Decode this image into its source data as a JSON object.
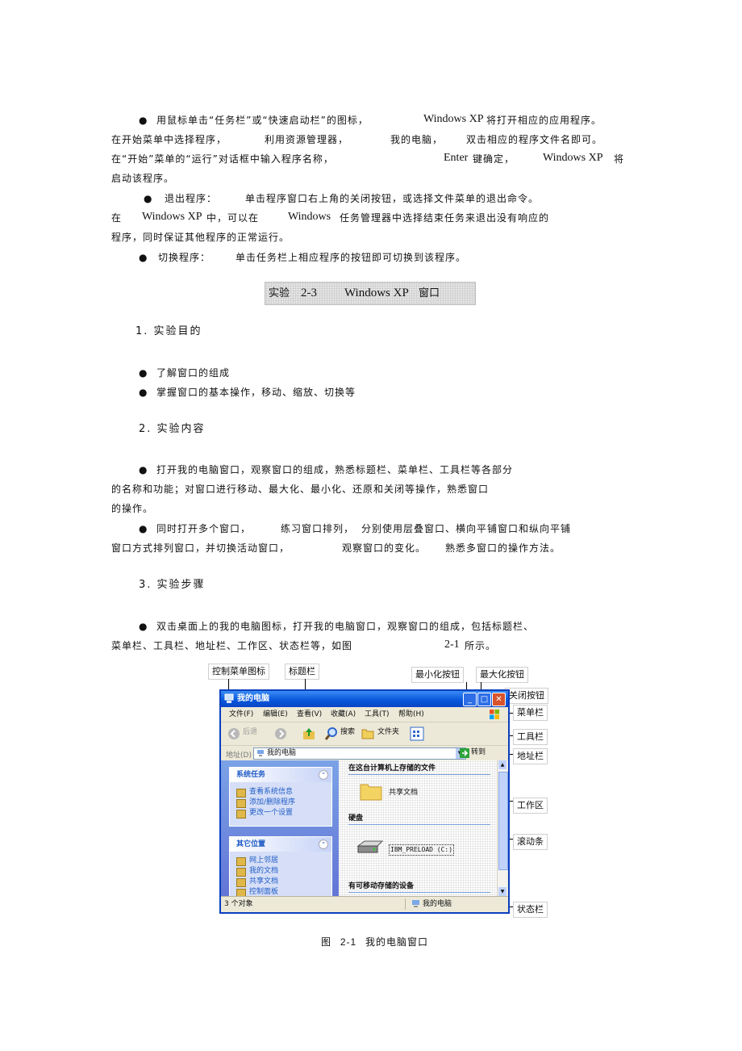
{
  "body": {
    "p1_l1_a": "用鼠标单击“任务栏”或“快速启动栏”的图标，",
    "p1_l1_b": "Windows  XP",
    "p1_l1_c": "将打开相应的应用程序。",
    "p1_l2_a": "在开始菜单中选择程序，",
    "p1_l2_b": "利用资源管理器，",
    "p1_l2_c": "我的电脑，",
    "p1_l2_d": "双击相应的程序文件名即可。",
    "p1_l3_a": "在“开始”菜单的“运行”对话框中输入程序名称，",
    "p1_l3_b": "Enter",
    "p1_l3_c": "键确定，",
    "p1_l3_d": "Windows XP",
    "p1_l3_e": "将",
    "p1_l4": "启动该程序。",
    "p2_l1_a": "退出程序：",
    "p2_l1_b": "单击程序窗口右上角的关闭按钮，或选择文件菜单的退出命令。",
    "p2_l2_a": "在",
    "p2_l2_b": "Windows  XP",
    "p2_l2_c": "中，可以在",
    "p2_l2_d": "Windows",
    "p2_l2_e": "任务管理器中选择结束任务来退出没有响应的",
    "p2_l3": "程序，同时保证其他程序的正常运行。",
    "p3_l1_a": "切换程序：",
    "p3_l1_b": "单击任务栏上相应程序的按钮即可切换到该程序。"
  },
  "heading": {
    "part1": "实验",
    "part2": "2-3",
    "part3": "Windows XP",
    "part4": "窗口"
  },
  "sections": {
    "s1": "1. 实验目的",
    "s1_item1": "了解窗口的组成",
    "s1_item2": "掌握窗口的基本操作，移动、缩放、切换等",
    "s2": "2. 实验内容",
    "s2_p1_l1": "打开我的电脑窗口，观察窗口的组成，熟悉标题栏、菜单栏、工具栏等各部分",
    "s2_p1_l2": "的名称和功能；对窗口进行移动、最大化、最小化、还原和关闭等操作，熟悉窗口",
    "s2_p1_l3": "的操作。",
    "s2_p2_l1_a": "同时打开多个窗口，",
    "s2_p2_l1_b": "练习窗口排列，",
    "s2_p2_l1_c": "分别使用层叠窗口、横向平铺窗口和纵向平铺",
    "s2_p2_l2_a": "窗口方式排列窗口，并切换活动窗口，",
    "s2_p2_l2_b": "观察窗口的变化。",
    "s2_p2_l2_c": "熟悉多窗口的操作方法。",
    "s3": "3. 实验步骤",
    "s3_p1_l1": "双击桌面上的我的电脑图标，打开我的电脑窗口，观察窗口的组成，包括标题栏、",
    "s3_p1_l2": "菜单栏、工具栏、地址栏、工作区、状态栏等，如图",
    "s3_p1_l2_b": "2-1",
    "s3_p1_l2_c": "所示。"
  },
  "figure": {
    "callouts": {
      "control_menu_icon": "控制菜单图标",
      "title_bar": "标题栏",
      "minimize": "最小化按钮",
      "maximize": "最大化按钮",
      "close": "关闭按钮",
      "menu_bar": "菜单栏",
      "toolbar": "工具栏",
      "address_bar": "地址栏",
      "work_area": "工作区",
      "scrollbar": "滚动条",
      "status_bar": "状态栏"
    },
    "window": {
      "title": "我的电脑",
      "menus": [
        "文件(F)",
        "编辑(E)",
        "查看(V)",
        "收藏(A)",
        "工具(T)",
        "帮助(H)"
      ],
      "toolbar_back": "后退",
      "toolbar_search": "搜索",
      "toolbar_folders": "文件夹",
      "address_label": "地址(D)",
      "address_value": "我的电脑",
      "go": "转到",
      "panel1_title": "系统任务",
      "panel1_items": [
        "查看系统信息",
        "添加/删除程序",
        "更改一个设置"
      ],
      "panel2_title": "其它位置",
      "panel2_items": [
        "网上邻居",
        "我的文档",
        "共享文档",
        "控制面板"
      ],
      "group1": "在这台计算机上存储的文件",
      "shared_docs": "共享文档",
      "group2": "硬盘",
      "drive": "IBM_PRELOAD (C:)",
      "group3": "有可移动存储的设备",
      "status_count": "3 个对象",
      "status_location": "我的电脑"
    },
    "caption_a": "图",
    "caption_b": "2-1",
    "caption_c": "我的电脑窗口"
  }
}
